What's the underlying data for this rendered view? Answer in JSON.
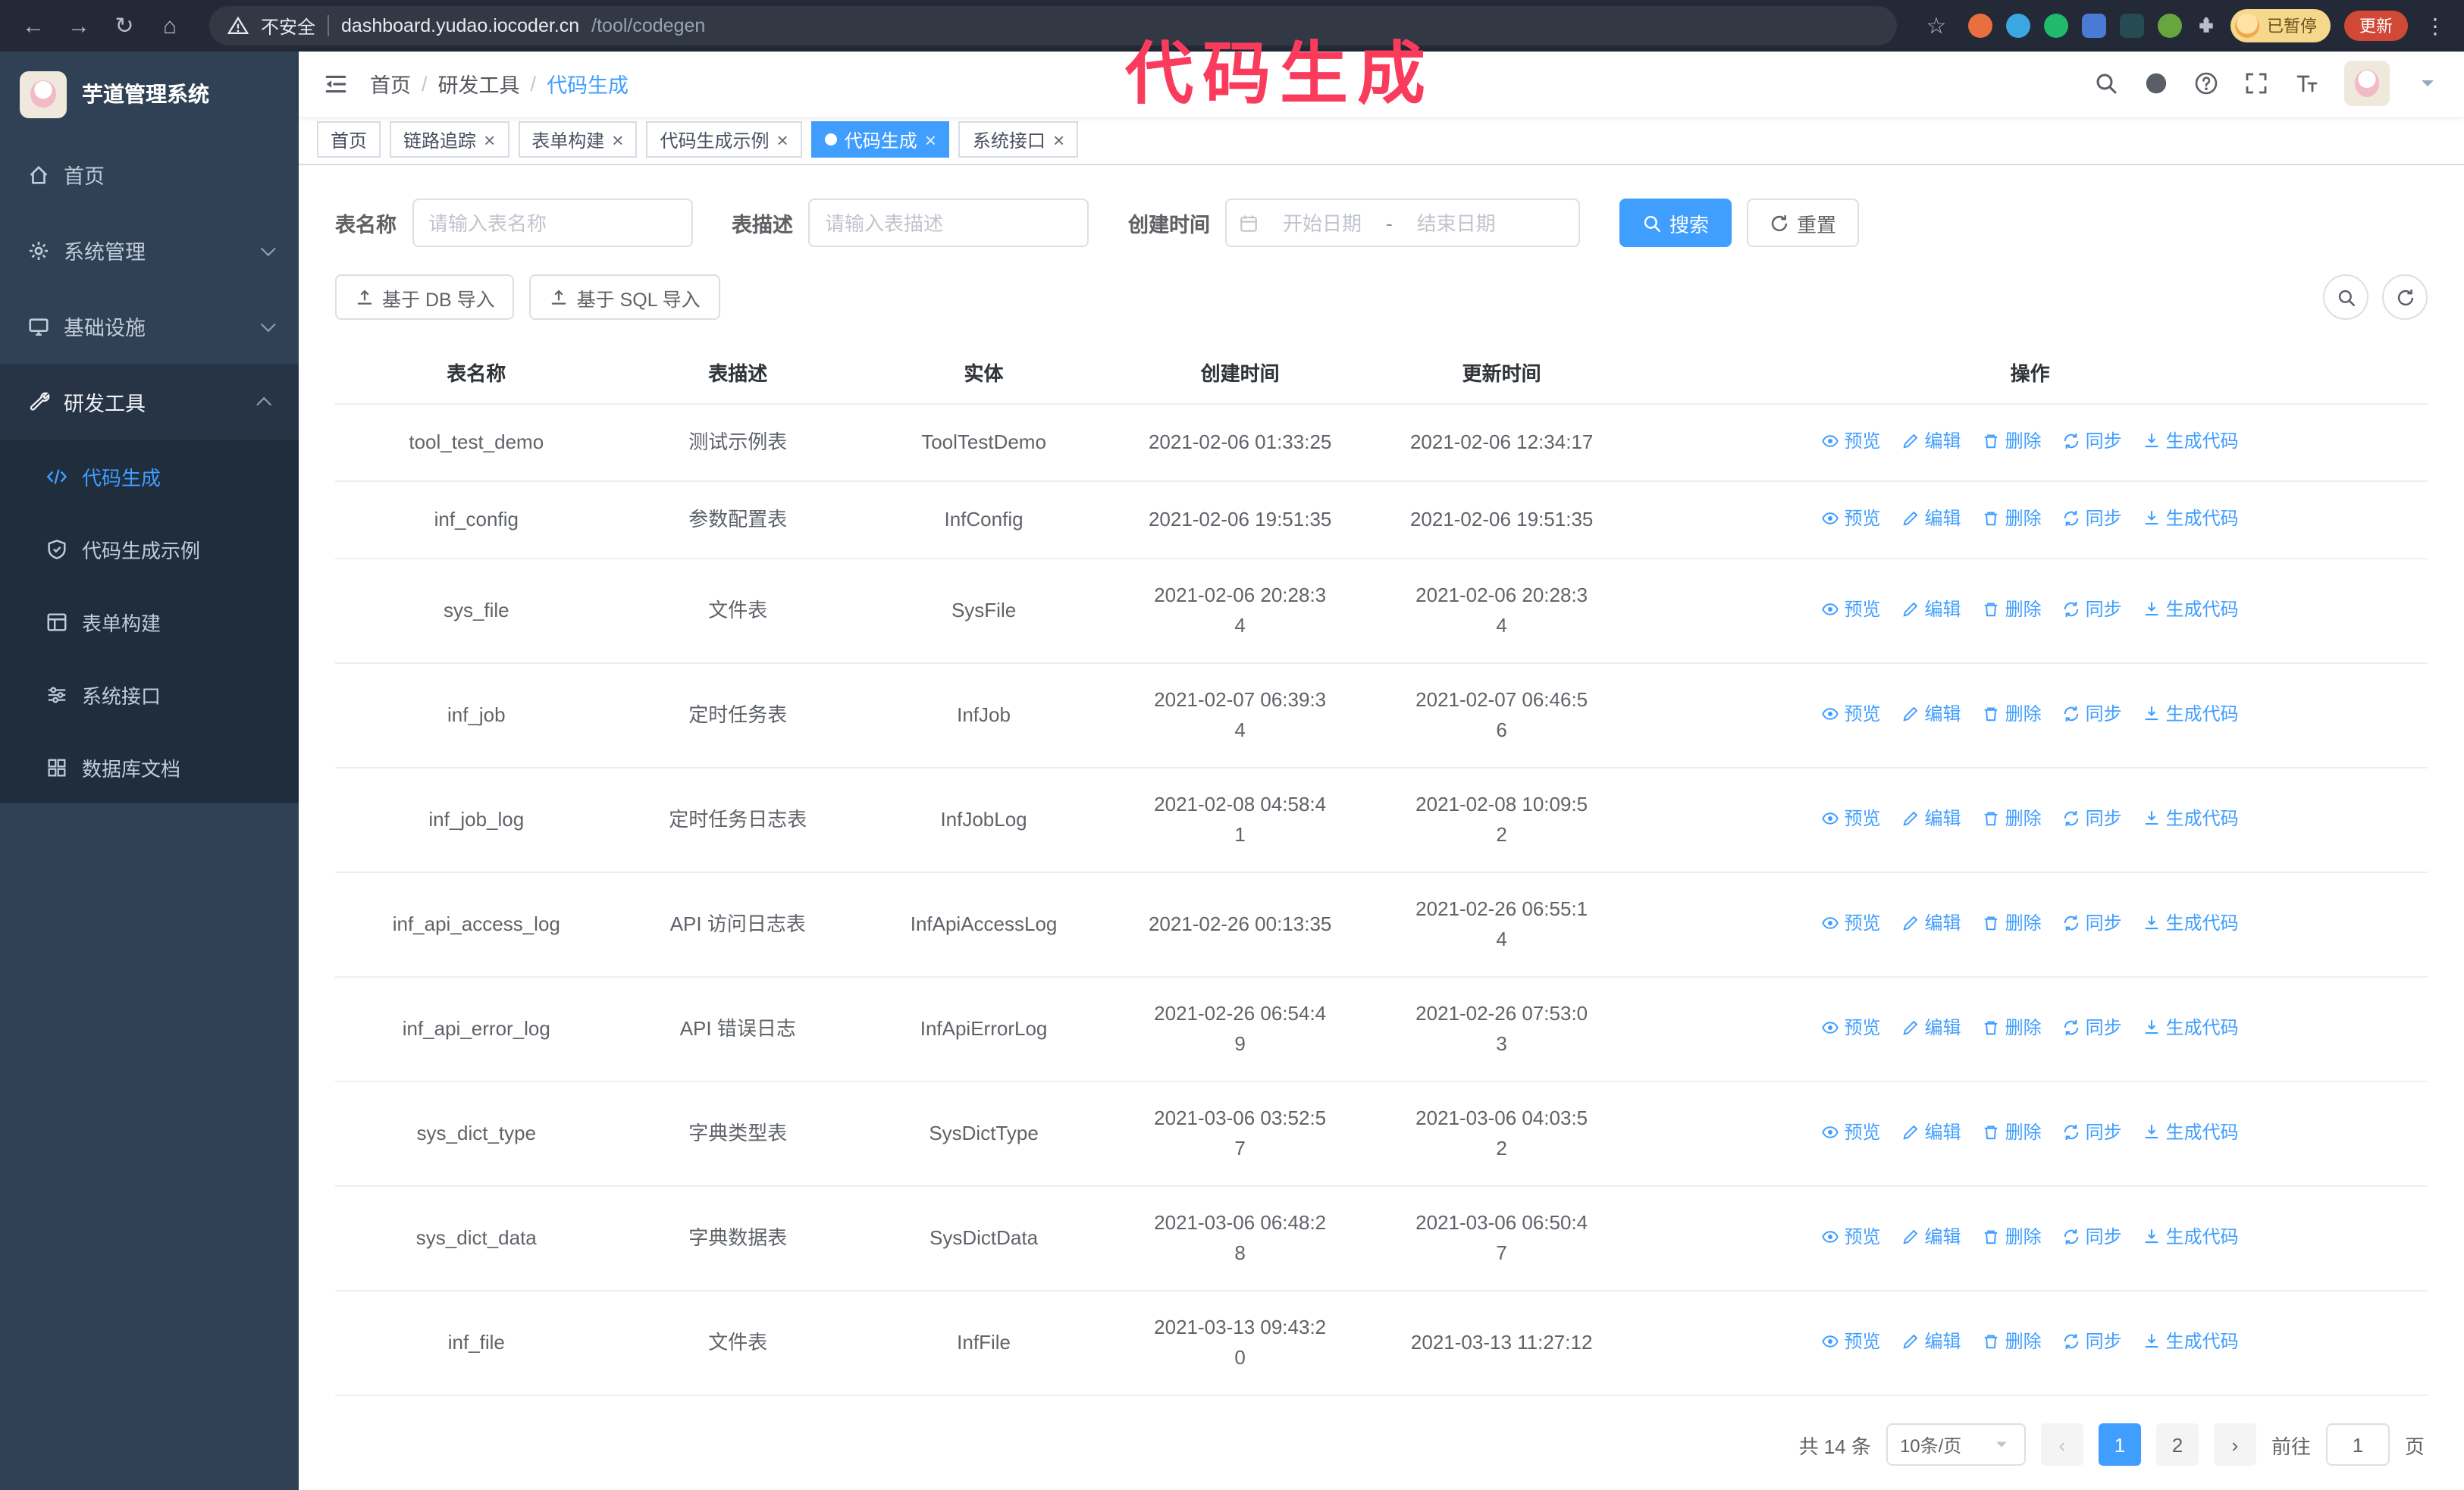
{
  "annotation": {
    "text": "代码生成"
  },
  "browser": {
    "security_label": "不安全",
    "url_host": "dashboard.yudao.iocoder.cn",
    "url_path": "/tool/codegen",
    "profile_badge": "已暂停",
    "update_label": "更新"
  },
  "icons": {
    "back": "←",
    "forward": "→",
    "reload": "↻",
    "home": "⌂",
    "star": "☆",
    "dots": "⋮",
    "close": "×",
    "breadcrumb_sep": "/",
    "prev": "‹",
    "next": "›"
  },
  "sidebar": {
    "logo_text": "芋道管理系统",
    "items": [
      {
        "label": "首页"
      },
      {
        "label": "系统管理"
      },
      {
        "label": "基础设施"
      },
      {
        "label": "研发工具"
      }
    ],
    "sub_items": [
      {
        "label": "代码生成",
        "active": true
      },
      {
        "label": "代码生成示例",
        "active": false
      },
      {
        "label": "表单构建",
        "active": false
      },
      {
        "label": "系统接口",
        "active": false
      },
      {
        "label": "数据库文档",
        "active": false
      }
    ]
  },
  "header": {
    "breadcrumb": [
      "首页",
      "研发工具",
      "代码生成"
    ]
  },
  "tabs": [
    {
      "label": "首页",
      "closable": false,
      "active": false
    },
    {
      "label": "链路追踪",
      "closable": true,
      "active": false
    },
    {
      "label": "表单构建",
      "closable": true,
      "active": false
    },
    {
      "label": "代码生成示例",
      "closable": true,
      "active": false
    },
    {
      "label": "代码生成",
      "closable": true,
      "active": true
    },
    {
      "label": "系统接口",
      "closable": true,
      "active": false
    }
  ],
  "filters": {
    "table_name_label": "表名称",
    "table_name_placeholder": "请输入表名称",
    "table_desc_label": "表描述",
    "table_desc_placeholder": "请输入表描述",
    "create_time_label": "创建时间",
    "date_start_placeholder": "开始日期",
    "date_separator": "-",
    "date_end_placeholder": "结束日期",
    "search_label": "搜索",
    "reset_label": "重置"
  },
  "toolbar": {
    "import_db_label": "基于 DB 导入",
    "import_sql_label": "基于 SQL 导入"
  },
  "table": {
    "columns": [
      "表名称",
      "表描述",
      "实体",
      "创建时间",
      "更新时间",
      "操作"
    ],
    "action_labels": [
      "预览",
      "编辑",
      "删除",
      "同步",
      "生成代码"
    ],
    "rows": [
      {
        "name": "tool_test_demo",
        "desc": "测试示例表",
        "entity": "ToolTestDemo",
        "created": "2021-02-06 01:33:25",
        "updated": "2021-02-06 12:34:17"
      },
      {
        "name": "inf_config",
        "desc": "参数配置表",
        "entity": "InfConfig",
        "created": "2021-02-06 19:51:35",
        "updated": "2021-02-06 19:51:35"
      },
      {
        "name": "sys_file",
        "desc": "文件表",
        "entity": "SysFile",
        "created": "2021-02-06 20:28:3\n4",
        "updated": "2021-02-06 20:28:3\n4"
      },
      {
        "name": "inf_job",
        "desc": "定时任务表",
        "entity": "InfJob",
        "created": "2021-02-07 06:39:3\n4",
        "updated": "2021-02-07 06:46:5\n6"
      },
      {
        "name": "inf_job_log",
        "desc": "定时任务日志表",
        "entity": "InfJobLog",
        "created": "2021-02-08 04:58:4\n1",
        "updated": "2021-02-08 10:09:5\n2"
      },
      {
        "name": "inf_api_access_log",
        "desc": "API 访问日志表",
        "entity": "InfApiAccessLog",
        "created": "2021-02-26 00:13:35",
        "updated": "2021-02-26 06:55:1\n4"
      },
      {
        "name": "inf_api_error_log",
        "desc": "API 错误日志",
        "entity": "InfApiErrorLog",
        "created": "2021-02-26 06:54:4\n9",
        "updated": "2021-02-26 07:53:0\n3"
      },
      {
        "name": "sys_dict_type",
        "desc": "字典类型表",
        "entity": "SysDictType",
        "created": "2021-03-06 03:52:5\n7",
        "updated": "2021-03-06 04:03:5\n2"
      },
      {
        "name": "sys_dict_data",
        "desc": "字典数据表",
        "entity": "SysDictData",
        "created": "2021-03-06 06:48:2\n8",
        "updated": "2021-03-06 06:50:4\n7"
      },
      {
        "name": "inf_file",
        "desc": "文件表",
        "entity": "InfFile",
        "created": "2021-03-13 09:43:2\n0",
        "updated": "2021-03-13 11:27:12"
      }
    ]
  },
  "pagination": {
    "total_text": "共 14 条",
    "page_size": "10条/页",
    "pages": [
      {
        "label": "1",
        "active": true
      },
      {
        "label": "2",
        "active": false
      }
    ],
    "goto_prefix": "前往",
    "goto_value": "1",
    "goto_suffix": "页"
  }
}
